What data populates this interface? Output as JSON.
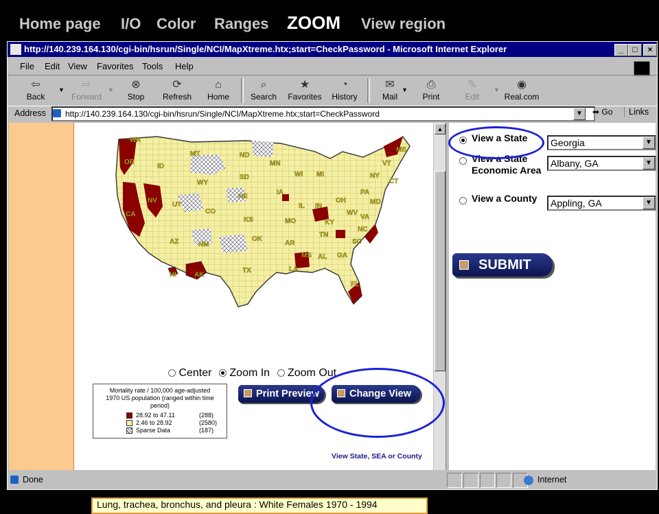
{
  "slide_nav": {
    "items": [
      {
        "label": "Home page"
      },
      {
        "label": "I/O"
      },
      {
        "label": "Color"
      },
      {
        "label": "Ranges"
      },
      {
        "label": "ZOOM"
      },
      {
        "label": "View region"
      }
    ],
    "active": "ZOOM"
  },
  "window": {
    "title": "http://140.239.164.130/cgi-bin/hsrun/Single/NCI/MapXtreme.htx;start=CheckPassword - Microsoft Internet Explorer",
    "controls": [
      "_",
      "□",
      "×"
    ]
  },
  "menu": [
    "File",
    "Edit",
    "View",
    "Favorites",
    "Tools",
    "Help"
  ],
  "toolbar": [
    {
      "label": "Back",
      "icon": "back-arrow-icon",
      "glyph": "⇦"
    },
    {
      "label": "Forward",
      "icon": "forward-arrow-icon",
      "glyph": "⇨",
      "disabled": true
    },
    {
      "label": "Stop",
      "icon": "stop-icon",
      "glyph": "⊗"
    },
    {
      "label": "Refresh",
      "icon": "refresh-icon",
      "glyph": "⟳"
    },
    {
      "label": "Home",
      "icon": "home-icon",
      "glyph": "⌂"
    },
    {
      "label": "Search",
      "icon": "search-icon",
      "glyph": "⌕"
    },
    {
      "label": "Favorites",
      "icon": "favorites-icon",
      "glyph": "★"
    },
    {
      "label": "History",
      "icon": "history-icon",
      "glyph": "◔"
    },
    {
      "label": "Mail",
      "icon": "mail-icon",
      "glyph": "✉"
    },
    {
      "label": "Print",
      "icon": "print-icon",
      "glyph": "⎙"
    },
    {
      "label": "Edit",
      "icon": "edit-icon",
      "glyph": "✎",
      "disabled": true
    },
    {
      "label": "Real.com",
      "icon": "realcom-icon",
      "glyph": "◉"
    }
  ],
  "address": {
    "label": "Address",
    "url": "http://140.239.164.130/cgi-bin/hsrun/Single/NCI/MapXtreme.htx;start=CheckPassword",
    "go_label": "Go",
    "links_label": "Links"
  },
  "map": {
    "states": [
      "WA",
      "OR",
      "CA",
      "NV",
      "ID",
      "MT",
      "WY",
      "UT",
      "AZ",
      "CO",
      "NM",
      "ND",
      "SD",
      "NE",
      "KS",
      "OK",
      "TX",
      "MN",
      "IA",
      "MO",
      "AR",
      "LA",
      "WI",
      "IL",
      "MI",
      "IN",
      "OH",
      "KY",
      "TN",
      "MS",
      "AL",
      "GA",
      "FL",
      "SC",
      "NC",
      "VA",
      "WV",
      "PA",
      "NY",
      "VT",
      "ME",
      "CT",
      "MD",
      "AK",
      "HI"
    ],
    "colors": {
      "high": "#8b0000",
      "mid": "#f5efa0",
      "sparse": "#ffffff",
      "border": "#333333"
    }
  },
  "zoom": {
    "options": [
      {
        "label": "Center",
        "selected": false
      },
      {
        "label": "Zoom In",
        "selected": true
      },
      {
        "label": "Zoom Out",
        "selected": false
      }
    ]
  },
  "legend": {
    "title_line1": "Mortality rate / 100,000 age-adjusted",
    "title_line2": "1970 US population (ranged within time period)",
    "rows": [
      {
        "range": "28.92 to 47.11",
        "count": "(288)",
        "color": "#8b0000"
      },
      {
        "range": "2.46 to 28.92",
        "count": "(2580)",
        "color": "#f5efa0"
      },
      {
        "range": "Sparse Data",
        "count": "(187)",
        "color": "#ffffff"
      }
    ]
  },
  "buttons": {
    "print_preview": "Print Preview",
    "change_view": "Change View",
    "change_view_caption": "View State, SEA or County",
    "submit": "SUBMIT"
  },
  "caption": "Lung, trachea, bronchus, and pleura : White Females 1970 - 1994",
  "view_panel": {
    "options": [
      {
        "label": "View a State",
        "selected": true,
        "select_value": "Georgia"
      },
      {
        "label": "View a State Economic Area",
        "selected": false,
        "select_value": "Albany, GA"
      },
      {
        "label": "View a County",
        "selected": false,
        "select_value": "Appling, GA"
      }
    ]
  },
  "status": {
    "left": "Done",
    "zone": "Internet"
  }
}
